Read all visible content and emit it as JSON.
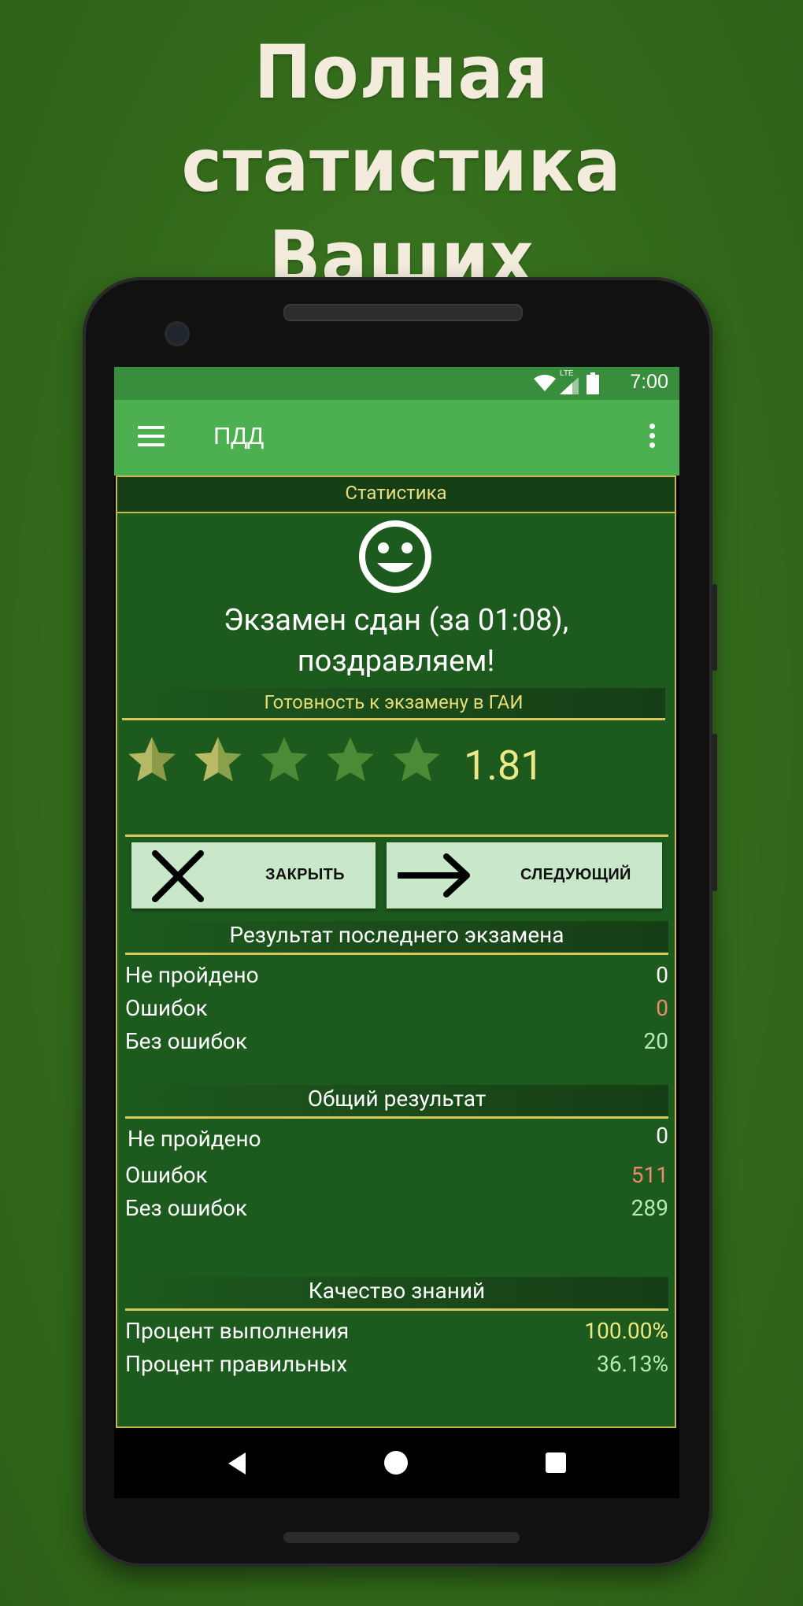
{
  "headline": {
    "line1": "Полная статистика",
    "line2": "Ваших результатов"
  },
  "status_bar": {
    "time": "7:00",
    "network": "LTE"
  },
  "app_bar": {
    "title": "ПДД"
  },
  "stats": {
    "header": "Статистика",
    "result_line1": "Экзамен сдан (за 01:08),",
    "result_line2": "поздравляем!",
    "readiness_title": "Готовность к экзамену в ГАИ",
    "rating": {
      "value": "1.81",
      "max_stars": 5,
      "filled_stars": 1.81
    }
  },
  "buttons": {
    "close_label": "ЗАКРЫТЬ",
    "next_label": "СЛЕДУЮЩИЙ"
  },
  "last_exam": {
    "title": "Результат последнего экзамена",
    "rows": [
      {
        "label": "Не пройдено",
        "value": "0"
      },
      {
        "label": "Ошибок",
        "value": "0"
      },
      {
        "label": "Без ошибок",
        "value": "20"
      }
    ]
  },
  "overall": {
    "title": "Общий результат",
    "rows": [
      {
        "label": "Не пройдено",
        "value": "0"
      },
      {
        "label": "Ошибок",
        "value": "511"
      },
      {
        "label": "Без ошибок",
        "value": "289"
      }
    ]
  },
  "quality": {
    "title": "Качество знаний",
    "rows": [
      {
        "label": "Процент выполнения",
        "value": "100.00%"
      },
      {
        "label": "Процент правильных",
        "value": "36.13%"
      }
    ]
  },
  "colors": {
    "background": "#336b1b",
    "app_bar": "#4caf50",
    "status_bar": "#388e3c",
    "panel": "#1d5a1d",
    "accent_gold": "#d8c85c",
    "star_filled": "#b5b864",
    "star_empty": "#4d8a35",
    "button": "#c9e8c9"
  }
}
